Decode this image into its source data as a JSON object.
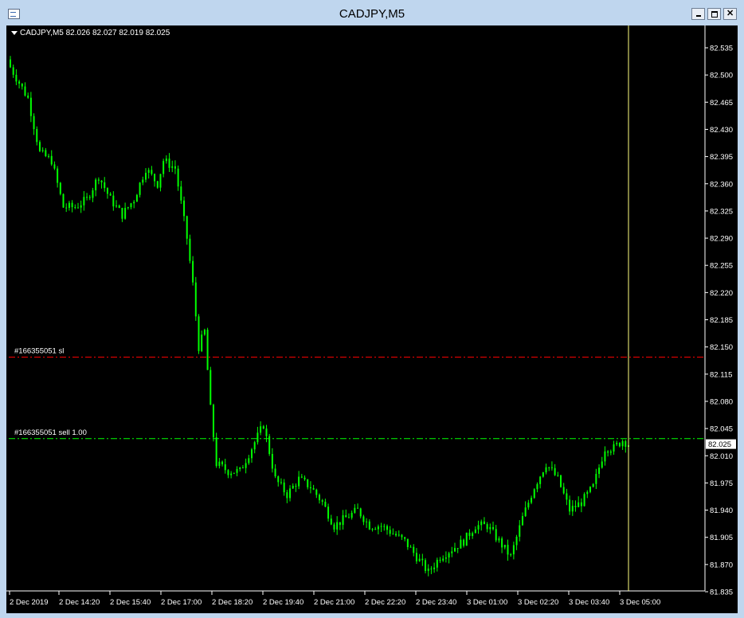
{
  "window": {
    "title": "CADJPY,M5",
    "buttons": [
      "minimize",
      "maximize",
      "close"
    ]
  },
  "header": {
    "symbol_info": "CADJPY,M5  82.026 82.027 82.019 82.025"
  },
  "colors": {
    "background": "#000000",
    "candle": "#00ff00",
    "axis": "#ffffff",
    "stop_loss_line": "#ff0000",
    "order_line": "#00ff00",
    "vertical_cursor": "#ffff80",
    "price_marker_bg": "#ffffff"
  },
  "chart_data": {
    "type": "candlestick",
    "symbol": "CADJPY",
    "timeframe": "M5",
    "ohlc_current": {
      "open": 82.026,
      "high": 82.027,
      "low": 82.019,
      "close": 82.025
    },
    "y_ticks": [
      "82.535",
      "82.500",
      "82.465",
      "82.430",
      "82.395",
      "82.360",
      "82.325",
      "82.290",
      "82.255",
      "82.220",
      "82.185",
      "82.150",
      "82.115",
      "82.080",
      "82.045",
      "82.010",
      "81.975",
      "81.940",
      "81.905",
      "81.870",
      "81.835"
    ],
    "ylim": [
      81.83,
      82.55
    ],
    "x_ticks": [
      "2 Dec 2019",
      "2 Dec 14:20",
      "2 Dec 15:40",
      "2 Dec 17:00",
      "2 Dec 18:20",
      "2 Dec 19:40",
      "2 Dec 21:00",
      "2 Dec 22:20",
      "2 Dec 23:40",
      "3 Dec 01:00",
      "3 Dec 02:20",
      "3 Dec 03:40",
      "3 Dec 05:00"
    ],
    "current_price_label": "82.025",
    "horizontal_lines": [
      {
        "label": "#166355051 sl",
        "price": 82.137,
        "style": "dash-dot",
        "color": "#ff0000"
      },
      {
        "label": "#166355051 sell 1.00",
        "price": 82.032,
        "style": "dash-dot",
        "color": "#00ff00"
      }
    ],
    "vertical_line_time": "3 Dec 05:00",
    "close_path": [
      [
        0,
        82.51
      ],
      [
        6,
        82.47
      ],
      [
        10,
        82.4
      ],
      [
        14,
        82.39
      ],
      [
        18,
        82.33
      ],
      [
        22,
        82.33
      ],
      [
        26,
        82.34
      ],
      [
        30,
        82.37
      ],
      [
        34,
        82.34
      ],
      [
        38,
        82.32
      ],
      [
        42,
        82.34
      ],
      [
        46,
        82.38
      ],
      [
        50,
        82.36
      ],
      [
        52,
        82.39
      ],
      [
        56,
        82.38
      ],
      [
        60,
        82.29
      ],
      [
        62,
        82.23
      ],
      [
        64,
        82.15
      ],
      [
        66,
        82.17
      ],
      [
        68,
        82.07
      ],
      [
        70,
        82.0
      ],
      [
        74,
        81.99
      ],
      [
        78,
        81.99
      ],
      [
        82,
        82.02
      ],
      [
        86,
        82.05
      ],
      [
        90,
        81.98
      ],
      [
        94,
        81.96
      ],
      [
        98,
        81.98
      ],
      [
        102,
        81.97
      ],
      [
        106,
        81.95
      ],
      [
        110,
        81.92
      ],
      [
        114,
        81.93
      ],
      [
        118,
        81.94
      ],
      [
        122,
        81.92
      ],
      [
        126,
        81.92
      ],
      [
        130,
        81.91
      ],
      [
        134,
        81.9
      ],
      [
        138,
        81.88
      ],
      [
        142,
        81.86
      ],
      [
        146,
        81.88
      ],
      [
        150,
        81.89
      ],
      [
        154,
        81.9
      ],
      [
        158,
        81.92
      ],
      [
        162,
        81.92
      ],
      [
        166,
        81.9
      ],
      [
        170,
        81.88
      ],
      [
        174,
        81.93
      ],
      [
        178,
        81.97
      ],
      [
        182,
        82.0
      ],
      [
        186,
        81.98
      ],
      [
        190,
        81.94
      ],
      [
        194,
        81.95
      ],
      [
        198,
        81.97
      ],
      [
        202,
        82.02
      ],
      [
        205,
        82.02
      ],
      [
        208,
        82.03
      ],
      [
        210,
        82.025
      ]
    ]
  }
}
